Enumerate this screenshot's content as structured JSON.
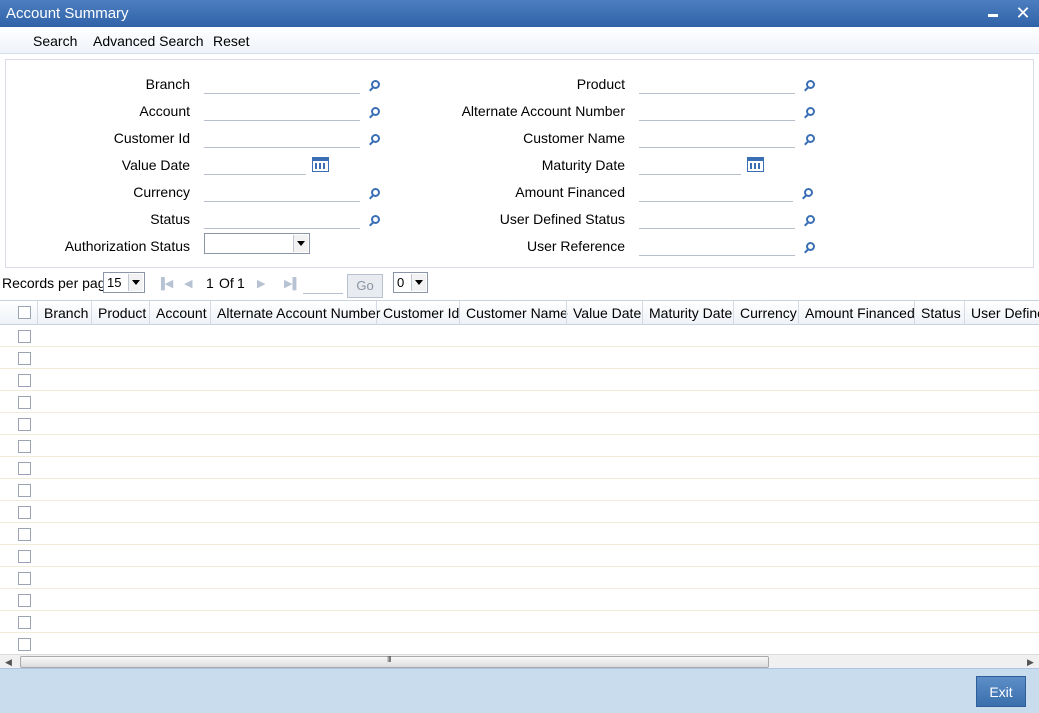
{
  "window": {
    "title": "Account Summary"
  },
  "toolbar": {
    "search": "Search",
    "advanced_search": "Advanced Search",
    "reset": "Reset"
  },
  "form": {
    "branch": "Branch",
    "account": "Account",
    "customer_id": "Customer Id",
    "value_date": "Value Date",
    "currency": "Currency",
    "status": "Status",
    "authorization_status": "Authorization Status",
    "product": "Product",
    "alternate_account_number": "Alternate Account Number",
    "customer_name": "Customer Name",
    "maturity_date": "Maturity Date",
    "amount_financed": "Amount Financed",
    "user_defined_status": "User Defined Status",
    "user_reference": "User Reference"
  },
  "pager": {
    "records_per_page_label": "Records per page",
    "records_per_page_value": "15",
    "current_page": "1",
    "of_label": "Of",
    "total_pages": "1",
    "go_label": "Go",
    "selector_value": "0"
  },
  "grid": {
    "columns": [
      "Branch",
      "Product",
      "Account",
      "Alternate Account Number",
      "Customer Id",
      "Customer Name",
      "Value Date",
      "Maturity Date",
      "Currency",
      "Amount Financed",
      "Status",
      "User Define"
    ]
  },
  "footer": {
    "exit": "Exit"
  },
  "colors": {
    "title_bar": "#3d6fb3",
    "footer_bg": "#c8dcee",
    "exit_button": "#4a7dba"
  }
}
